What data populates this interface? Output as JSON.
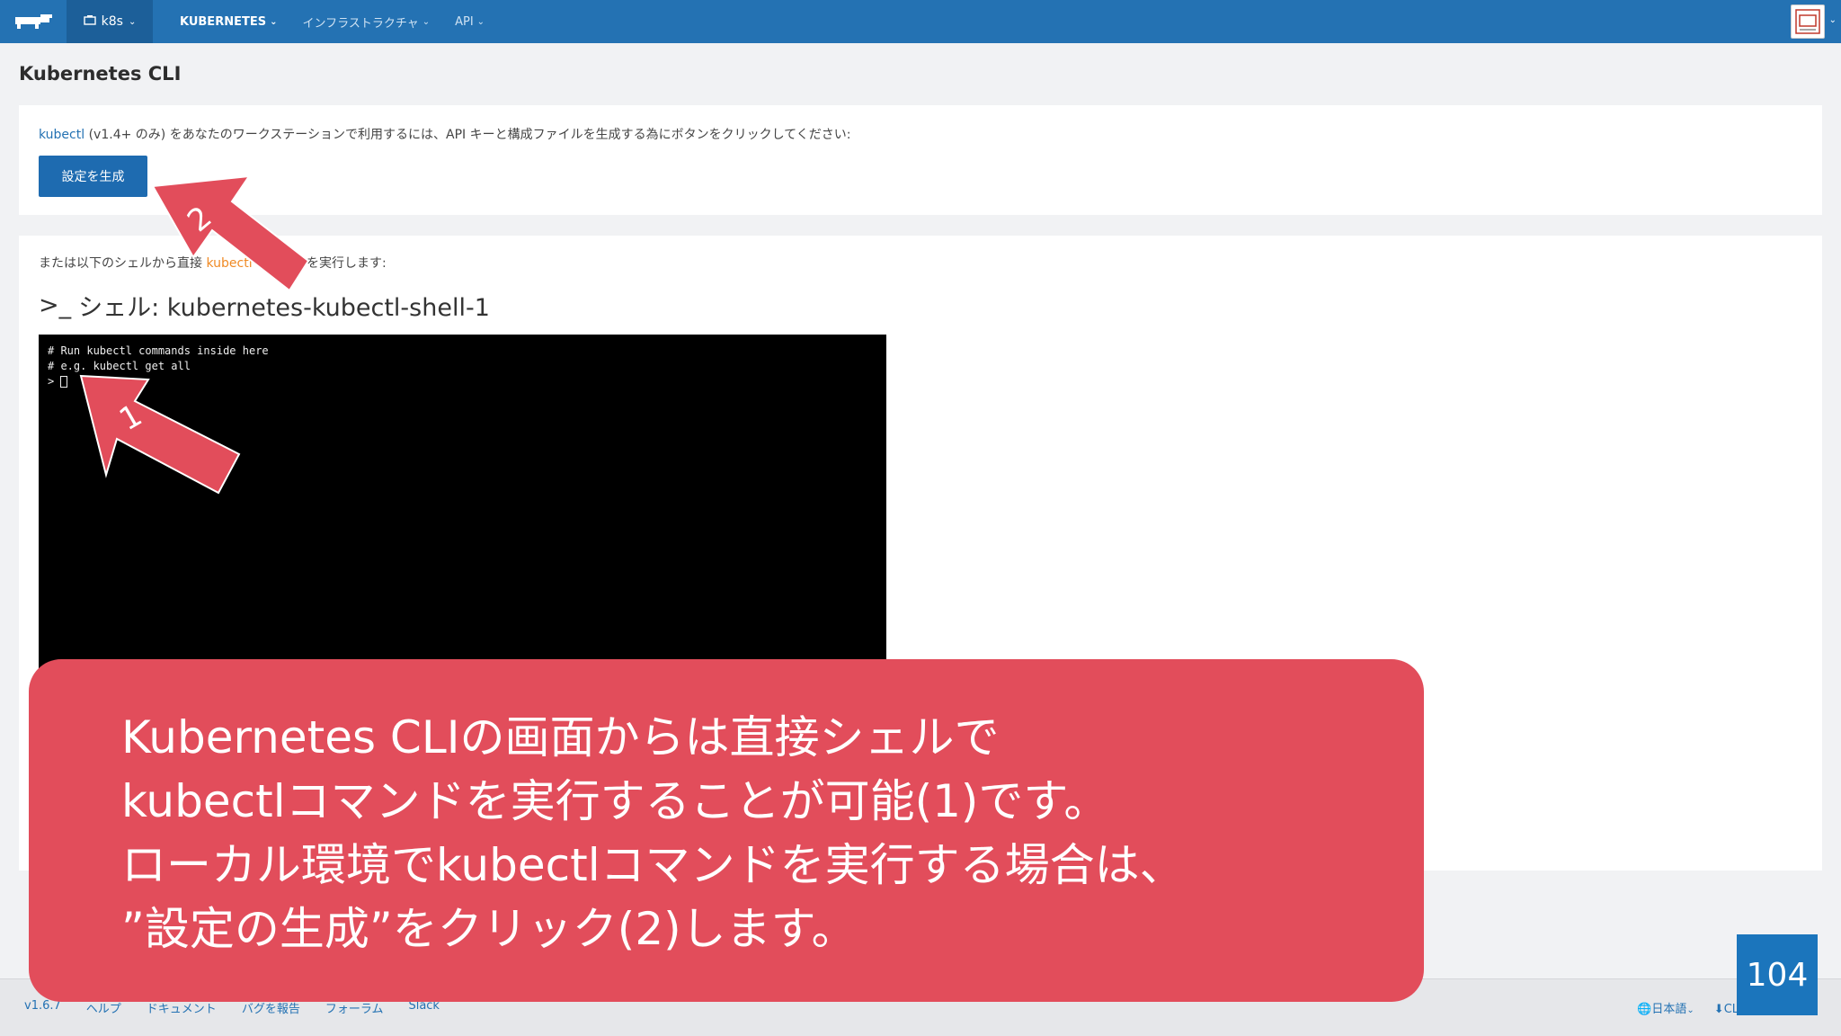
{
  "nav": {
    "environment": "k8s",
    "items": [
      {
        "label": "KUBERNETES"
      },
      {
        "label": "インフラストラクチャ"
      },
      {
        "label": "API"
      }
    ]
  },
  "page": {
    "title": "Kubernetes CLI"
  },
  "config_card": {
    "link_text": "kubectl",
    "intro_rest": " (v1.4+ のみ) をあなたのワークステーションで利用するには、API キーと構成ファイルを生成する為にボタンをクリックしてください:",
    "button_label": "設定を生成"
  },
  "shell_card": {
    "or_prefix": "または以下のシェルから直接 ",
    "or_link": "kubectl",
    "or_suffix": " コマンドを実行します:",
    "shell_icon": ">_",
    "shell_title": "シェル: kubernetes-kubectl-shell-1",
    "terminal_lines": [
      "# Run kubectl commands inside here",
      "# e.g. kubectl get all"
    ],
    "prompt": "> "
  },
  "footer": {
    "links": [
      "v1.6.7",
      "ヘルプ",
      "ドキュメント",
      "バグを報告",
      "フォーラム",
      "Slack"
    ],
    "language": "日本語",
    "download": "CLI をダ"
  },
  "annotations": {
    "marker_1": "1",
    "marker_2": "2",
    "callout_lines": [
      "Kubernetes CLIの画面からは直接シェルで",
      "kubectlコマンドを実行することが可能(1)です。",
      "ローカル環境でkubectlコマンドを実行する場合は、",
      "”設定の生成”をクリック(2)します。"
    ],
    "page_number": "104",
    "callout_color": "#e24d5b",
    "accent_color": "#2472b3"
  }
}
